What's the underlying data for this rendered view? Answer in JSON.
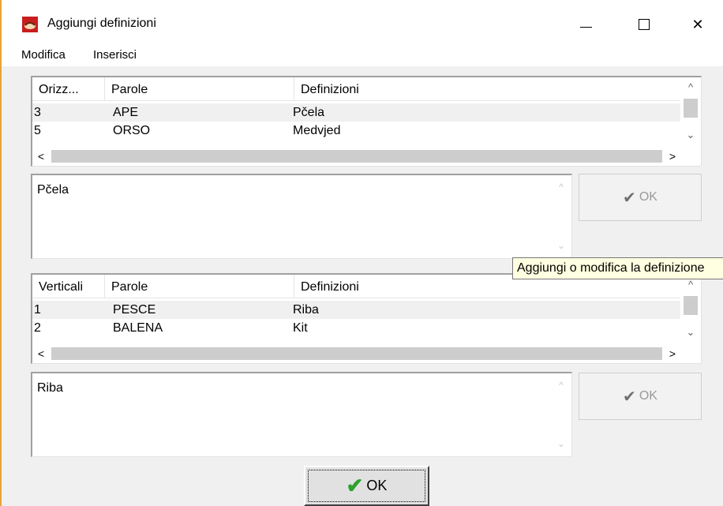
{
  "window": {
    "title": "Aggiungi definizioni",
    "close_glyph": "✕"
  },
  "menu": [
    "Modifica",
    "Inserisci"
  ],
  "horizontal": {
    "columns": [
      "Orizz...",
      "Parole",
      "Definizioni"
    ],
    "rows": [
      {
        "num": "3",
        "word": "APE",
        "definition": "Pčela"
      },
      {
        "num": "5",
        "word": "ORSO",
        "definition": "Medvjed"
      }
    ],
    "editor_text": "Pčela",
    "ok_label": "OK"
  },
  "vertical": {
    "columns": [
      "Verticali",
      "Parole",
      "Definizioni"
    ],
    "rows": [
      {
        "num": "1",
        "word": "PESCE",
        "definition": "Riba"
      },
      {
        "num": "2",
        "word": "BALENA",
        "definition": "Kit"
      }
    ],
    "editor_text": "Riba",
    "ok_label": "OK"
  },
  "tooltip": "Aggiungi o modifica la definizione",
  "footer": {
    "ok_label": "OK"
  },
  "icons": {
    "check": "✔",
    "arrow_up": "^",
    "arrow_down": "⌄",
    "arrow_left": "<",
    "arrow_right": ">"
  },
  "colors": {
    "accent_green": "#2ca12c",
    "tooltip_bg": "#ffffe1",
    "selected_row": "#f0f0f0"
  }
}
